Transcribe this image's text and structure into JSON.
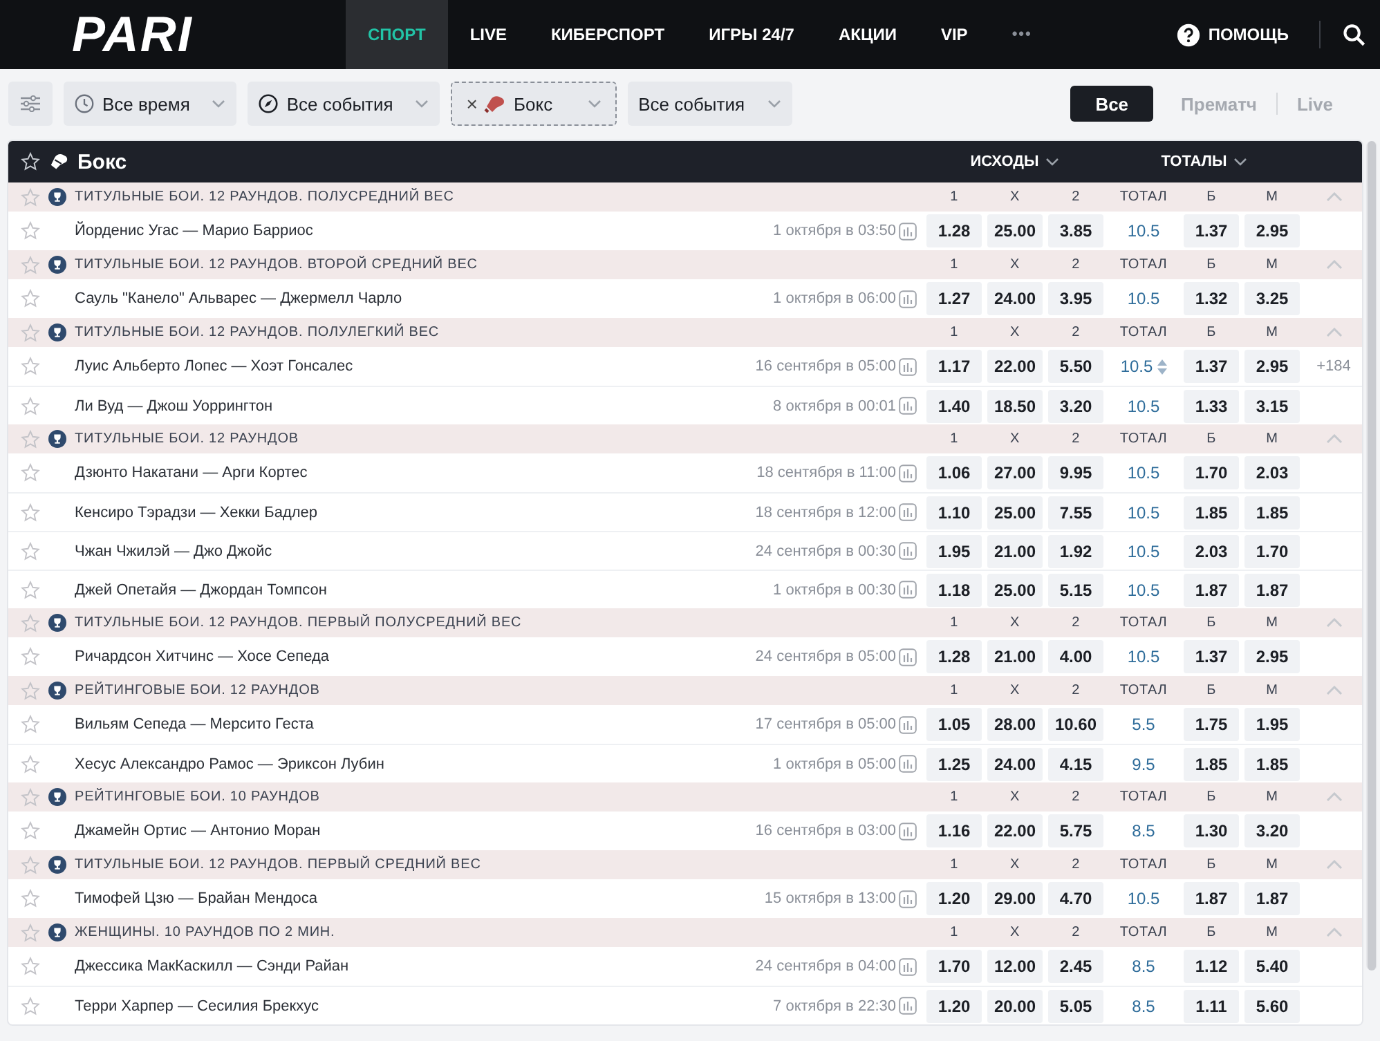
{
  "nav": {
    "logo": "PARI",
    "items": [
      {
        "label": "СПОРТ",
        "selected": true
      },
      {
        "label": "LIVE",
        "selected": false
      },
      {
        "label": "КИБЕРСПОРТ",
        "selected": false
      },
      {
        "label": "ИГРЫ 24/7",
        "selected": false
      },
      {
        "label": "АКЦИИ",
        "selected": false
      },
      {
        "label": "VIP",
        "selected": false
      }
    ],
    "more": "•••",
    "help": "ПОМОЩЬ"
  },
  "filters": [
    {
      "kind": "time",
      "label": "Все время"
    },
    {
      "kind": "events",
      "label": "Все события"
    },
    {
      "kind": "sport",
      "label": "Бокс",
      "remove": "×"
    },
    {
      "kind": "plain",
      "label": "Все события"
    }
  ],
  "modes": [
    {
      "label": "Все",
      "selected": true
    },
    {
      "label": "Прематч",
      "selected": false
    },
    {
      "label": "Live",
      "selected": false
    }
  ],
  "table": {
    "title": "Бокс",
    "outcomes": "ИСХОДЫ",
    "totals": "ТОТАЛЫ",
    "groups": [
      {
        "title": "ТИТУЛЬНЫЕ БОИ. 12 РАУНДОВ. ПОЛУСРЕДНИЙ ВЕС",
        "columns": [
          "1",
          "X",
          "2",
          "ТОТАЛ",
          "Б",
          "М"
        ],
        "matches": [
          {
            "name": "Йорденис Угас — Марио Барриос",
            "date": "1 октября в 03:50",
            "odds": [
              "1.28",
              "25.00",
              "3.85"
            ],
            "total": "10.5",
            "total_arrows": false,
            "over": "1.37",
            "under": "2.95"
          }
        ]
      },
      {
        "title": "ТИТУЛЬНЫЕ БОИ. 12 РАУНДОВ. ВТОРОЙ СРЕДНИЙ ВЕС",
        "columns": [
          "1",
          "X",
          "2",
          "ТОТАЛ",
          "Б",
          "М"
        ],
        "matches": [
          {
            "name": "Сауль \"Канело\" Альварес — Джермелл Чарло",
            "date": "1 октября в 06:00",
            "odds": [
              "1.27",
              "24.00",
              "3.95"
            ],
            "total": "10.5",
            "total_arrows": false,
            "over": "1.32",
            "under": "3.25"
          }
        ]
      },
      {
        "title": "ТИТУЛЬНЫЕ БОИ. 12 РАУНДОВ. ПОЛУЛЕГКИЙ ВЕС",
        "columns": [
          "1",
          "X",
          "2",
          "ТОТАЛ",
          "Б",
          "М"
        ],
        "matches": [
          {
            "name": "Луис Альберто Лопес — Хоэт Гонсалес",
            "date": "16 сентября в 05:00",
            "odds": [
              "1.17",
              "22.00",
              "5.50"
            ],
            "total": "10.5",
            "total_arrows": true,
            "over": "1.37",
            "under": "2.95",
            "more": "+184"
          },
          {
            "name": "Ли Вуд — Джош Уоррингтон",
            "date": "8 октября в 00:01",
            "odds": [
              "1.40",
              "18.50",
              "3.20"
            ],
            "total": "10.5",
            "total_arrows": false,
            "over": "1.33",
            "under": "3.15"
          }
        ]
      },
      {
        "title": "ТИТУЛЬНЫЕ БОИ. 12 РАУНДОВ",
        "columns": [
          "1",
          "X",
          "2",
          "ТОТАЛ",
          "Б",
          "М"
        ],
        "matches": [
          {
            "name": "Дзюнто Накатани — Арги Кортес",
            "date": "18 сентября в 11:00",
            "odds": [
              "1.06",
              "27.00",
              "9.95"
            ],
            "total": "10.5",
            "total_arrows": false,
            "over": "1.70",
            "under": "2.03"
          },
          {
            "name": "Кенсиро Тэрадзи — Хекки Бадлер",
            "date": "18 сентября в 12:00",
            "odds": [
              "1.10",
              "25.00",
              "7.55"
            ],
            "total": "10.5",
            "total_arrows": false,
            "over": "1.85",
            "under": "1.85"
          },
          {
            "name": "Чжан Чжилэй — Джо Джойс",
            "date": "24 сентября в 00:30",
            "odds": [
              "1.95",
              "21.00",
              "1.92"
            ],
            "total": "10.5",
            "total_arrows": false,
            "over": "2.03",
            "under": "1.70"
          },
          {
            "name": "Джей Опетайя — Джордан Томпсон",
            "date": "1 октября в 00:30",
            "odds": [
              "1.18",
              "25.00",
              "5.15"
            ],
            "total": "10.5",
            "total_arrows": false,
            "over": "1.87",
            "under": "1.87"
          }
        ]
      },
      {
        "title": "ТИТУЛЬНЫЕ БОИ. 12 РАУНДОВ. ПЕРВЫЙ ПОЛУСРЕДНИЙ ВЕС",
        "columns": [
          "1",
          "X",
          "2",
          "ТОТАЛ",
          "Б",
          "М"
        ],
        "matches": [
          {
            "name": "Ричардсон Хитчинс — Хосе Сепеда",
            "date": "24 сентября в 05:00",
            "odds": [
              "1.28",
              "21.00",
              "4.00"
            ],
            "total": "10.5",
            "total_arrows": false,
            "over": "1.37",
            "under": "2.95"
          }
        ]
      },
      {
        "title": "РЕЙТИНГОВЫЕ БОИ. 12 РАУНДОВ",
        "columns": [
          "1",
          "X",
          "2",
          "ТОТАЛ",
          "Б",
          "М"
        ],
        "matches": [
          {
            "name": "Вильям Сепеда — Мерсито Геста",
            "date": "17 сентября в 05:00",
            "odds": [
              "1.05",
              "28.00",
              "10.60"
            ],
            "total": "5.5",
            "total_arrows": false,
            "over": "1.75",
            "under": "1.95"
          },
          {
            "name": "Хесус Александро Рамос — Эриксон Лубин",
            "date": "1 октября в 05:00",
            "odds": [
              "1.25",
              "24.00",
              "4.15"
            ],
            "total": "9.5",
            "total_arrows": false,
            "over": "1.85",
            "under": "1.85"
          }
        ]
      },
      {
        "title": "РЕЙТИНГОВЫЕ БОИ. 10 РАУНДОВ",
        "columns": [
          "1",
          "X",
          "2",
          "ТОТАЛ",
          "Б",
          "М"
        ],
        "matches": [
          {
            "name": "Джамейн Ортис — Антонио Моран",
            "date": "16 сентября в 03:00",
            "odds": [
              "1.16",
              "22.00",
              "5.75"
            ],
            "total": "8.5",
            "total_arrows": false,
            "over": "1.30",
            "under": "3.20"
          }
        ]
      },
      {
        "title": "ТИТУЛЬНЫЕ БОИ. 12 РАУНДОВ. ПЕРВЫЙ СРЕДНИЙ ВЕС",
        "columns": [
          "1",
          "X",
          "2",
          "ТОТАЛ",
          "Б",
          "М"
        ],
        "matches": [
          {
            "name": "Тимофей Цзю — Брайан Мендоса",
            "date": "15 октября в 13:00",
            "odds": [
              "1.20",
              "29.00",
              "4.70"
            ],
            "total": "10.5",
            "total_arrows": false,
            "over": "1.87",
            "under": "1.87"
          }
        ]
      },
      {
        "title": "ЖЕНЩИНЫ. 10 РАУНДОВ ПО 2 МИН.",
        "columns": [
          "1",
          "X",
          "2",
          "ТОТАЛ",
          "Б",
          "М"
        ],
        "matches": [
          {
            "name": "Джессика МакКаскилл — Сэнди Райан",
            "date": "24 сентября в 04:00",
            "odds": [
              "1.70",
              "12.00",
              "2.45"
            ],
            "total": "8.5",
            "total_arrows": false,
            "over": "1.12",
            "under": "5.40"
          },
          {
            "name": "Терри Харпер — Сесилия Брекхус",
            "date": "7 октября в 22:30",
            "odds": [
              "1.20",
              "20.00",
              "5.05"
            ],
            "total": "8.5",
            "total_arrows": false,
            "over": "1.11",
            "under": "5.60"
          }
        ]
      }
    ]
  }
}
